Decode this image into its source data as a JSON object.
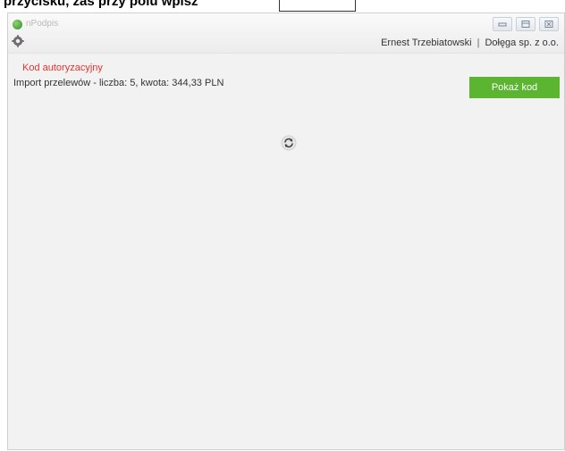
{
  "document": {
    "cut_text": "przycisku, zaś przy polu wpisz"
  },
  "window": {
    "app_title": "nPodpis",
    "user_name": "Ernest Trzebiatowski",
    "separator": "|",
    "company": "Dołęga sp. z o.o."
  },
  "main": {
    "auth_title": "Kod autoryzacyjny",
    "auth_description": "Import przelewów - liczba: 5, kwota: 344,33 PLN",
    "show_code_button": "Pokaż kod"
  },
  "colors": {
    "accent_green": "#5cb531",
    "alert_red": "#e8312f"
  },
  "icons": [
    "app-logo-icon",
    "gear-icon",
    "minimize-icon",
    "maximize-icon",
    "close-icon",
    "refresh-spinner-icon"
  ]
}
